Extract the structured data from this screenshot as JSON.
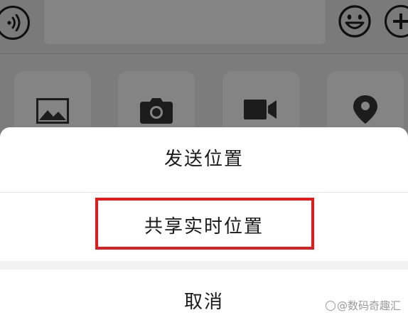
{
  "input_bar": {
    "left_icon": "voice-icon",
    "right_icons": [
      "emoji-icon",
      "plus-icon"
    ]
  },
  "attachment_tiles": [
    {
      "icon": "image-icon"
    },
    {
      "icon": "camera-icon"
    },
    {
      "icon": "video-icon"
    },
    {
      "icon": "location-pin-icon"
    }
  ],
  "action_sheet": {
    "options": [
      {
        "label": "发送位置"
      },
      {
        "label": "共享实时位置",
        "highlighted": true
      }
    ],
    "cancel_label": "取消"
  },
  "watermark": {
    "text": "@数码奇趣汇"
  },
  "colors": {
    "overlay": "#7c7c7c",
    "sheet_background": "#ffffff",
    "highlight_border": "#e21a1a",
    "text": "#1a1a1a"
  }
}
